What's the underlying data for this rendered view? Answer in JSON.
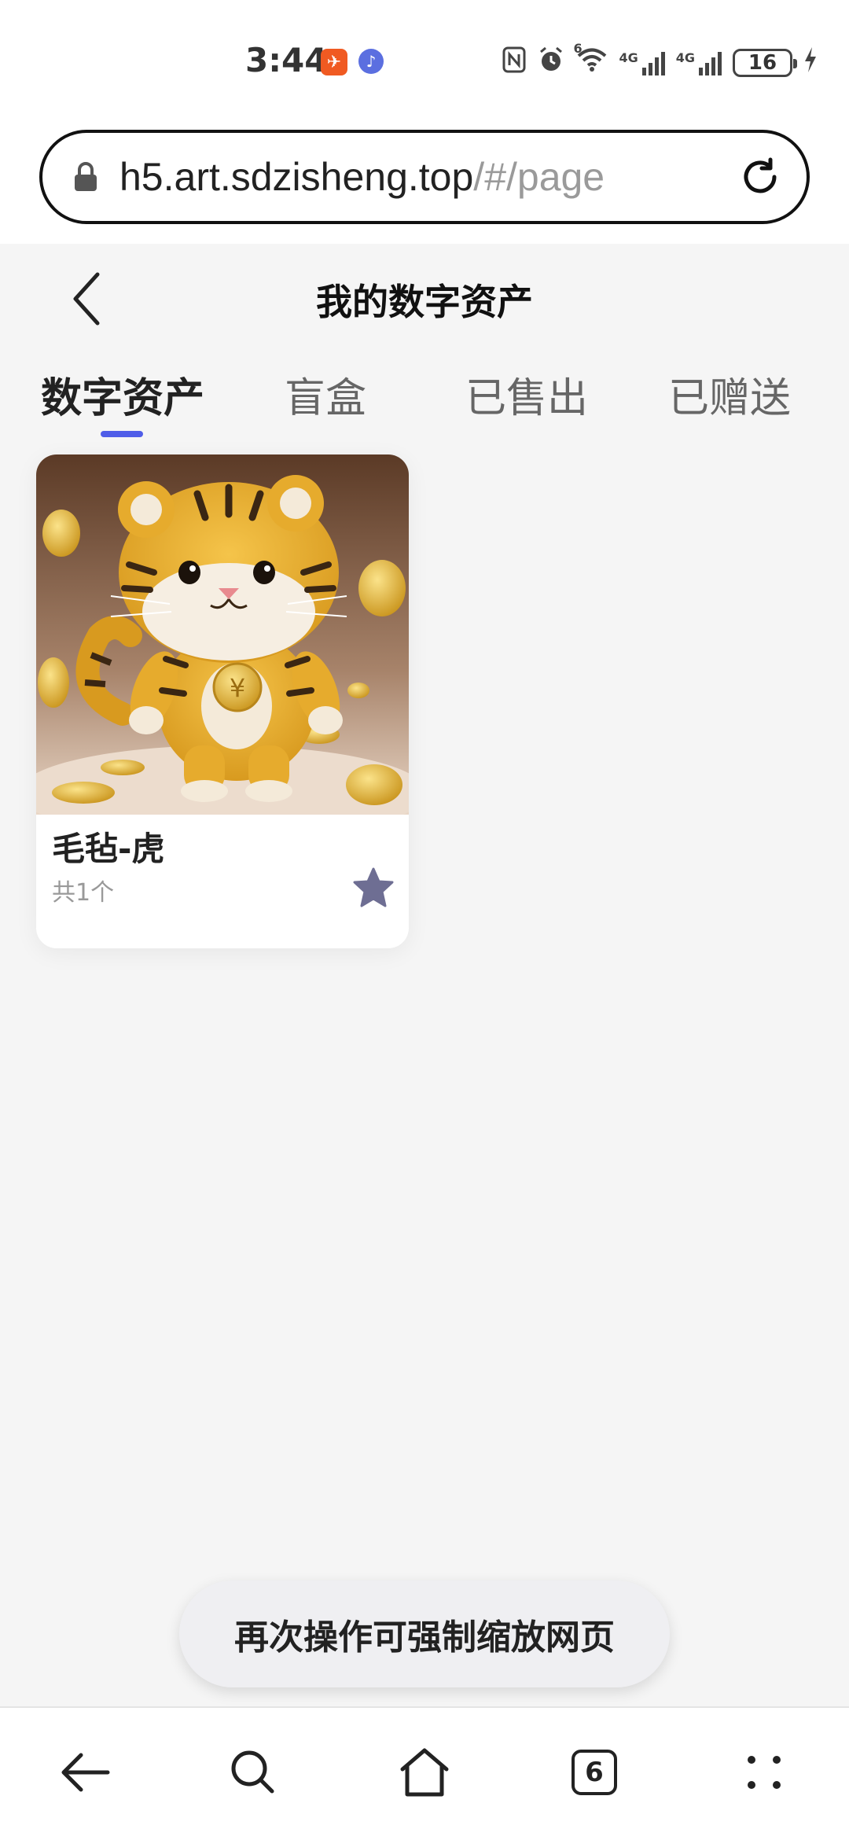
{
  "status_bar": {
    "time": "3:44",
    "battery": "16",
    "network_1": "4G",
    "network_2": "4G",
    "wifi_badge": "6"
  },
  "browser": {
    "url_host": "h5.art.sdzisheng.top",
    "url_path": "/#/page",
    "tab_count": "6"
  },
  "header": {
    "title": "我的数字资产"
  },
  "tabs": [
    {
      "label": "数字资产",
      "active": true
    },
    {
      "label": "盲盒",
      "active": false
    },
    {
      "label": "已售出",
      "active": false
    },
    {
      "label": "已赠送",
      "active": false
    }
  ],
  "assets": [
    {
      "name": "毛毡-虎",
      "count": "共1个"
    }
  ],
  "toast": {
    "text": "再次操作可强制缩放网页"
  },
  "colors": {
    "accent": "#4f5de8",
    "star": "#6e6e93",
    "background": "#f5f5f5"
  },
  "icons": {
    "back": "chevron-left-icon",
    "star": "star-icon",
    "lock": "lock-icon",
    "reload": "reload-icon"
  }
}
